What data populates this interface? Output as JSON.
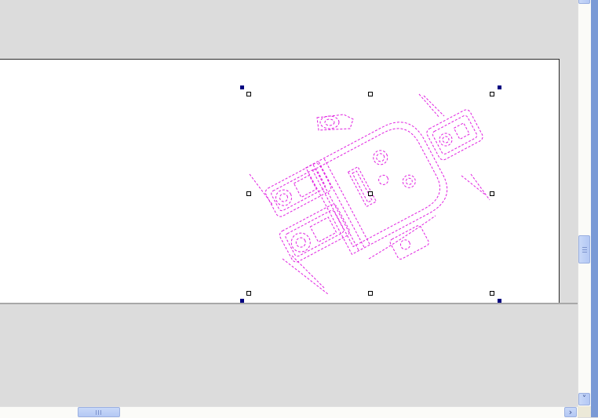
{
  "document": {
    "artwork": "robot-illustration",
    "outline_color": "#e020e0",
    "selection": {
      "handle_color": "#000000",
      "corner_marker_color": "#000080"
    }
  },
  "scrollbars": {
    "vertical": {
      "down_arrow": "˅",
      "thumb_icon": "grip-icon"
    },
    "horizontal": {
      "right_arrow": "›",
      "thumb_icon": "grip-icon"
    }
  }
}
